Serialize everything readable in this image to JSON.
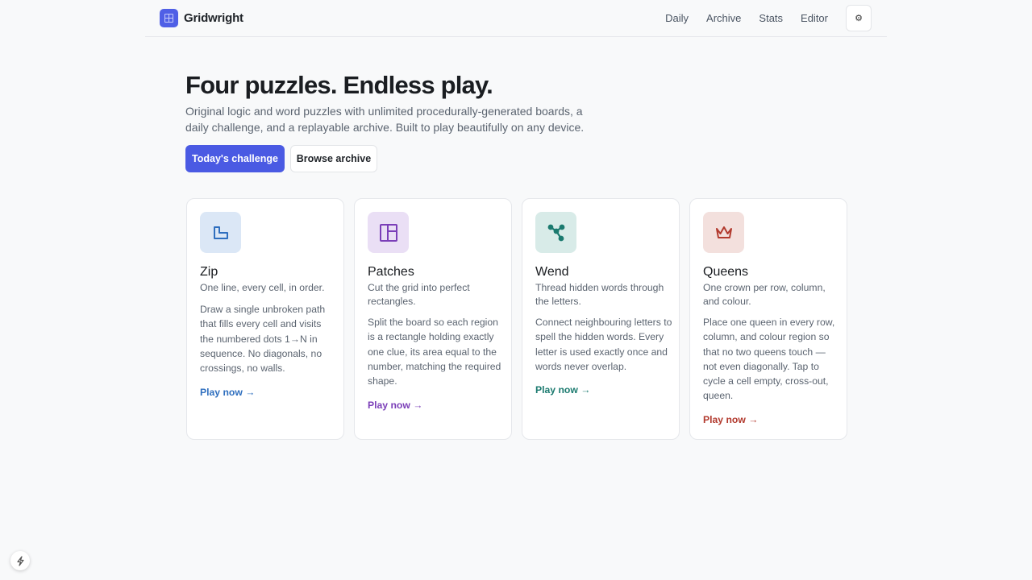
{
  "app": {
    "name": "Gridwright"
  },
  "nav": {
    "items": [
      "Daily",
      "Archive",
      "Stats",
      "Editor"
    ],
    "theme_icon": "⚙"
  },
  "hero": {
    "title": "Four puzzles. Endless play.",
    "subtitle": "Original logic and word puzzles with unlimited procedurally-generated boards, a daily challenge, and a replayable archive. Built to play beautifully on any device.",
    "primary_cta": "Today's challenge",
    "secondary_cta": "Browse archive"
  },
  "cards": [
    {
      "title": "Zip",
      "tagline": "One line, every cell, in order.",
      "description": "Draw a single unbroken path that fills every cell and visits the numbered dots 1→N in sequence. No diagonals, no crossings, no walls.",
      "play": "Play now →",
      "icon": "path-icon",
      "accent": "#2f6fbf",
      "icon_bg": "#dbe7f6"
    },
    {
      "title": "Patches",
      "tagline": "Cut the grid into perfect rectangles.",
      "description": "Split the board so each region is a rectangle holding exactly one clue, its area equal to the number, matching the required shape.",
      "play": "Play now →",
      "icon": "layout-icon",
      "accent": "#7b3fb8",
      "icon_bg": "#eadff5"
    },
    {
      "title": "Wend",
      "tagline": "Thread hidden words through the letters.",
      "description": "Connect neighbouring letters to spell the hidden words. Every letter is used exactly once and words never overlap.",
      "play": "Play now →",
      "icon": "share-nodes-icon",
      "accent": "#1b7a6f",
      "icon_bg": "#d8ebe8"
    },
    {
      "title": "Queens",
      "tagline": "One crown per row, column, and colour.",
      "description": "Place one queen in every row, column, and colour region so that no two queens touch — not even diagonally. Tap to cycle a cell empty, cross-out, queen.",
      "play": "Play now →",
      "icon": "crown-icon",
      "accent": "#b23a2e",
      "icon_bg": "#f3e0dd"
    }
  ],
  "fab_icon": "lightning-icon"
}
